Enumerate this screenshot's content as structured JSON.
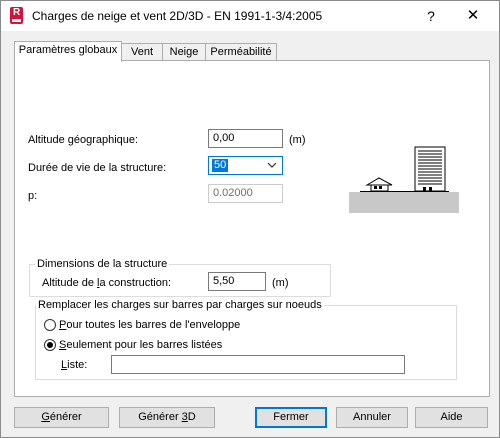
{
  "window": {
    "title": "Charges de neige et vent 2D/3D - EN 1991-1-3/4:2005",
    "help_glyph": "?",
    "close_glyph": "✕",
    "icon": "robot-app-icon"
  },
  "tabs": [
    {
      "label": "Paramètres globaux",
      "active": true
    },
    {
      "label": "Vent",
      "active": false
    },
    {
      "label": "Neige",
      "active": false
    },
    {
      "label": "Perméabilité",
      "active": false
    }
  ],
  "global_params": {
    "altitude_label": "Altitude géographique:",
    "altitude_value": "0,00",
    "altitude_unit": "(m)",
    "lifetime_label": "Durée de vie de la structure:",
    "lifetime_value": "50",
    "p_label": "p:",
    "p_value": "0.02000"
  },
  "dimensions": {
    "group_title": "Dimensions de la structure",
    "construction_altitude_prefix": "Altitude de ",
    "construction_altitude_mnemonic": "l",
    "construction_altitude_suffix": "a construction:",
    "construction_altitude_value": "5,50",
    "construction_altitude_unit": "(m)"
  },
  "replace_loads": {
    "group_title": "Remplacer les charges sur barres par charges sur noeuds",
    "option_all_mnemonic": "P",
    "option_all_rest": "our toutes les barres de l'enveloppe",
    "option_all_checked": false,
    "option_listed_mnemonic": "S",
    "option_listed_rest": "eulement pour les barres listées",
    "option_listed_checked": true,
    "list_mnemonic": "L",
    "list_rest": "iste:",
    "list_value": ""
  },
  "buttons": {
    "generate_mnemonic": "G",
    "generate_rest": "énérer",
    "generate3d_prefix": "Générer ",
    "generate3d_mnemonic": "3",
    "generate3d_suffix": "D",
    "close": "Fermer",
    "cancel": "Annuler",
    "help": "Aide"
  },
  "colors": {
    "accent": "#0078d7",
    "brand": "#d6113a",
    "illustration_bg": "#c8c8c8"
  }
}
